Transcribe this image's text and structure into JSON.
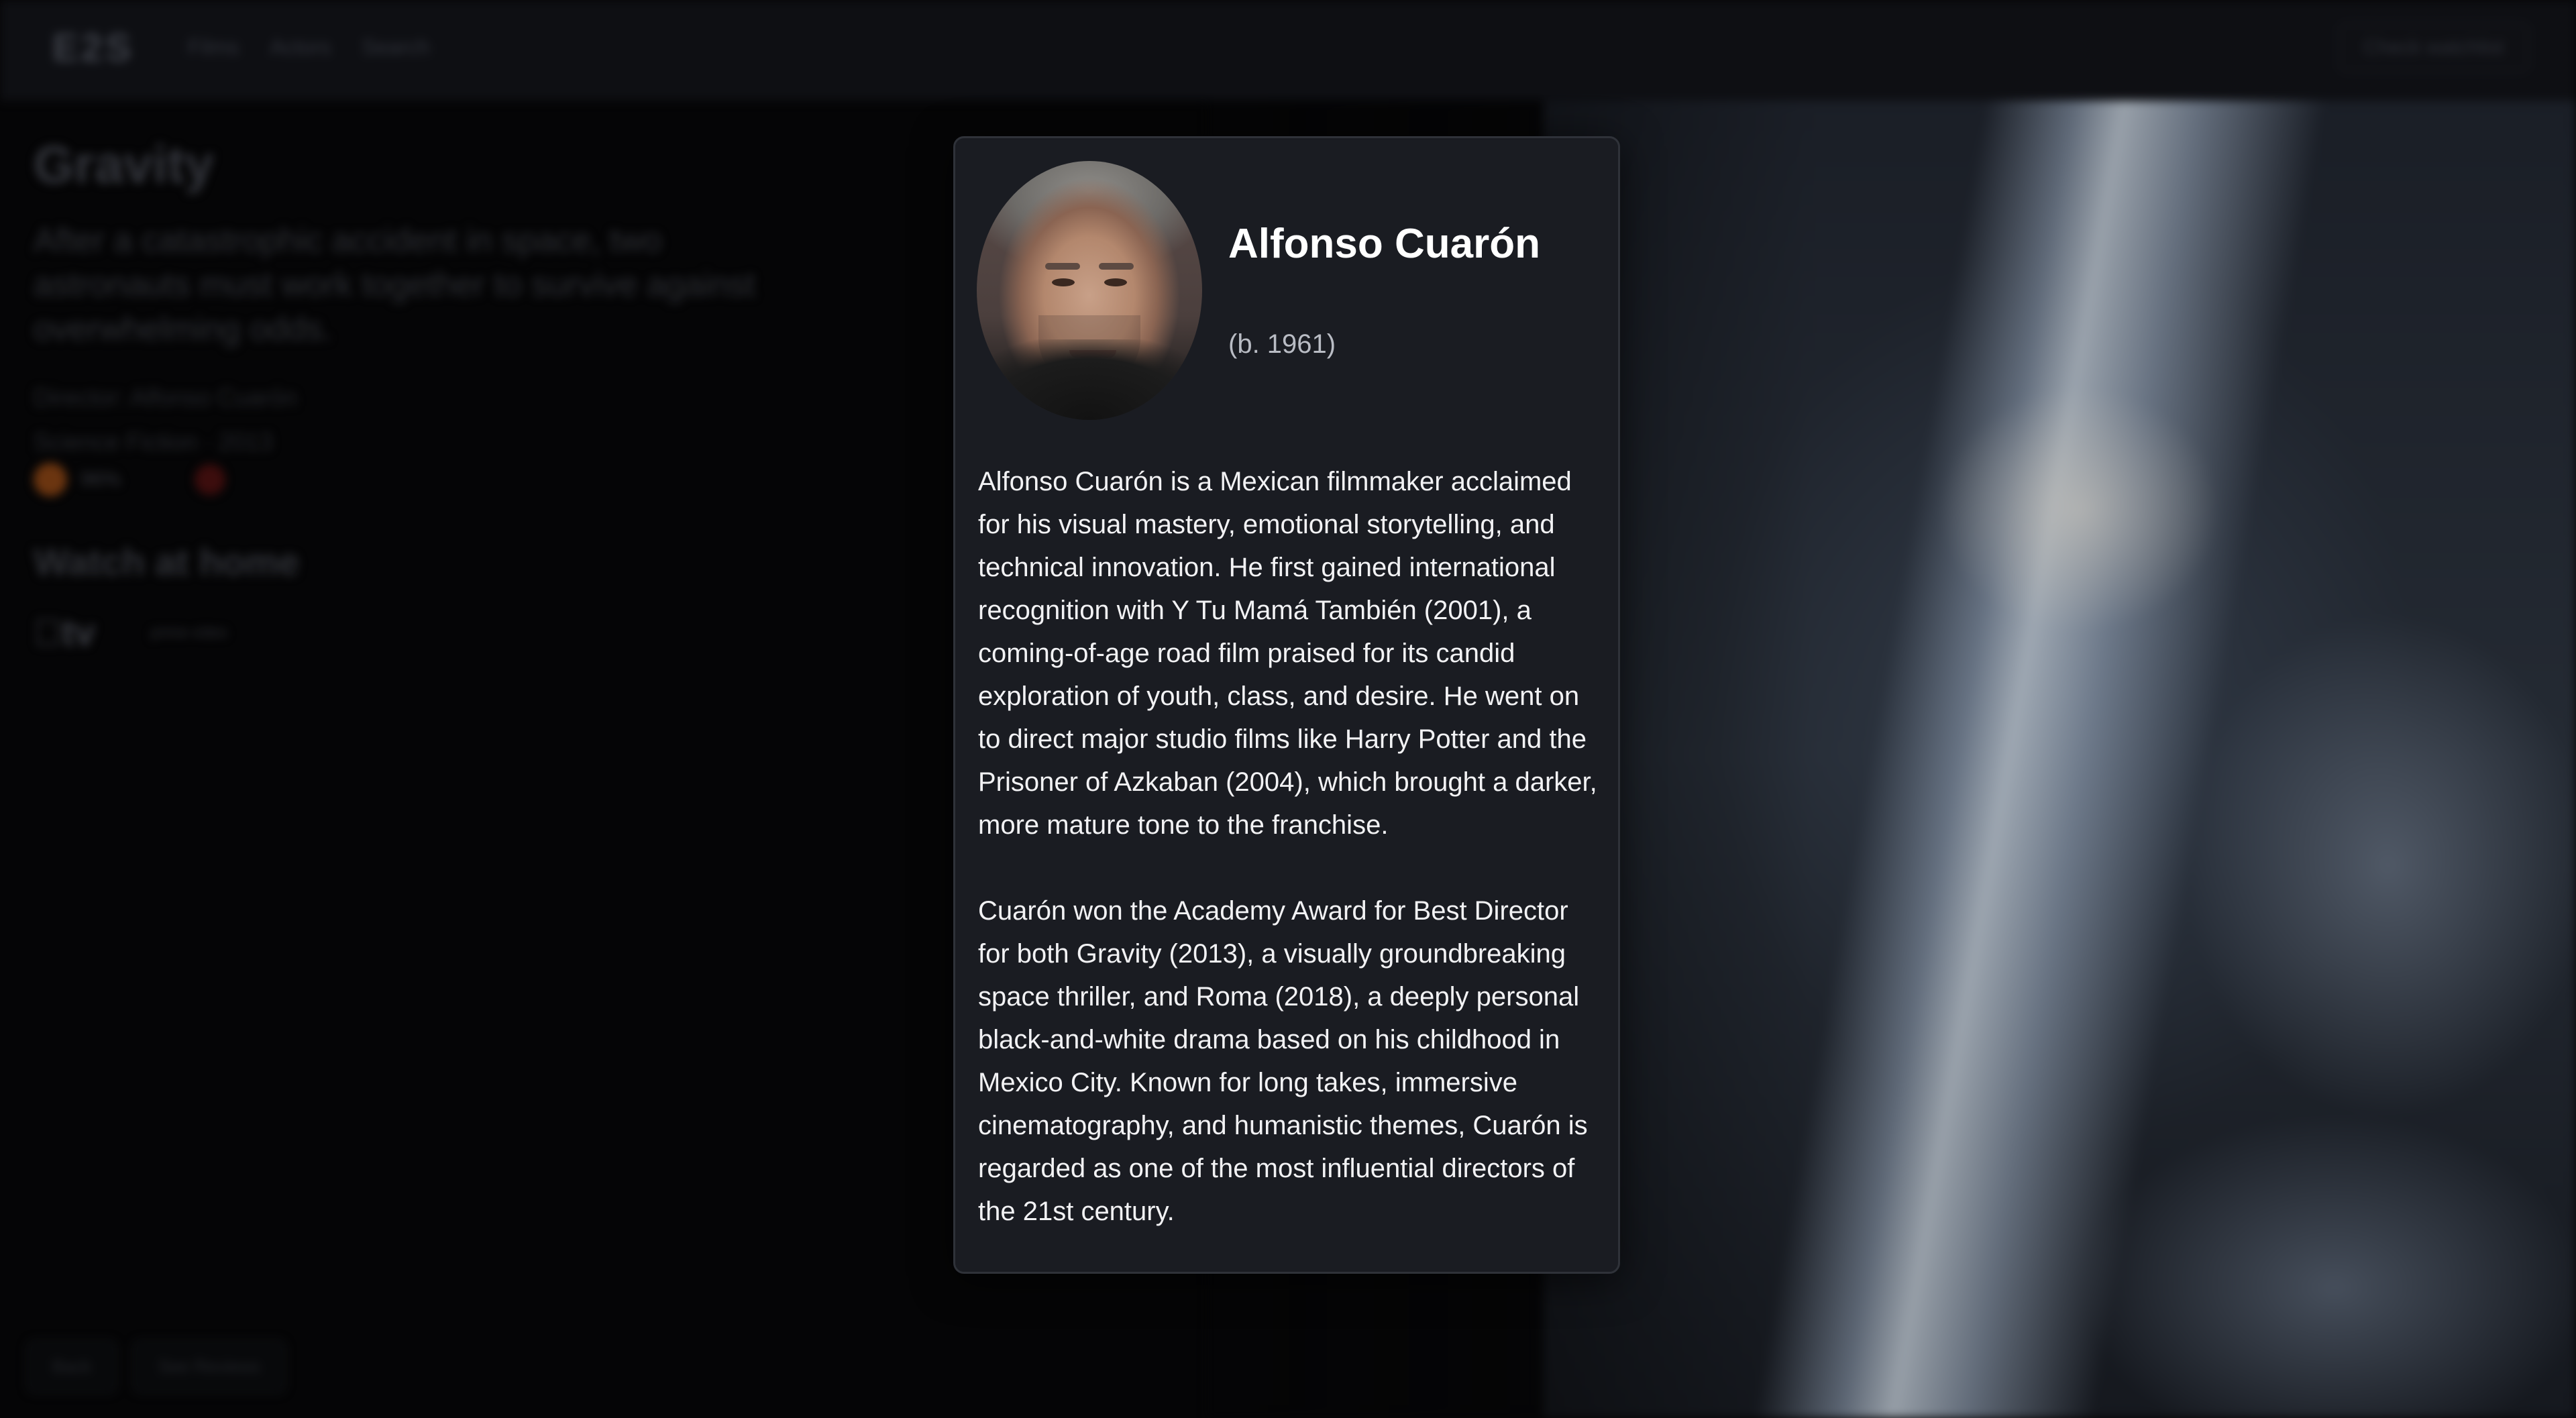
{
  "background": {
    "logo": "E2S",
    "nav": [
      "Films",
      "Actors",
      "Search"
    ],
    "top_button": "Check watchlist",
    "movie": {
      "title": "Gravity",
      "description": "After a catastrophic accident in space, two astronauts must work together to survive against overwhelming odds.",
      "director": "Director: Alfonso Cuarón",
      "genre_year": "Science Fiction · 2013",
      "rt_score": "96%"
    },
    "watch_title": "Watch at home",
    "providers": {
      "appletv": "tv",
      "prime": "prime video"
    },
    "bottom_buttons": [
      "Back",
      "See Reviews"
    ]
  },
  "modal": {
    "name": "Alfonso Cuarón",
    "born": "(b. 1961)",
    "bio": [
      "Alfonso Cuarón is a Mexican filmmaker acclaimed for his visual mastery, emotional storytelling, and technical innovation. He first gained international recognition with Y Tu Mamá También (2001), a coming-of-age road film praised for its candid exploration of youth, class, and desire. He went on to direct major studio films like Harry Potter and the Prisoner of Azkaban (2004), which brought a darker, more mature tone to the franchise.",
      "Cuarón won the Academy Award for Best Director for both Gravity (2013), a visually groundbreaking space thriller, and Roma (2018), a deeply personal black-and-white drama based on his childhood in Mexico City. Known for long takes, immersive cinematography, and humanistic themes, Cuarón is regarded as one of the most influential directors of the 21st century."
    ]
  },
  "colors": {
    "modal_bg": "#1a1c22",
    "modal_border": "#2f3239",
    "text_primary": "#ffffff",
    "text_secondary": "#b9bcc4"
  }
}
